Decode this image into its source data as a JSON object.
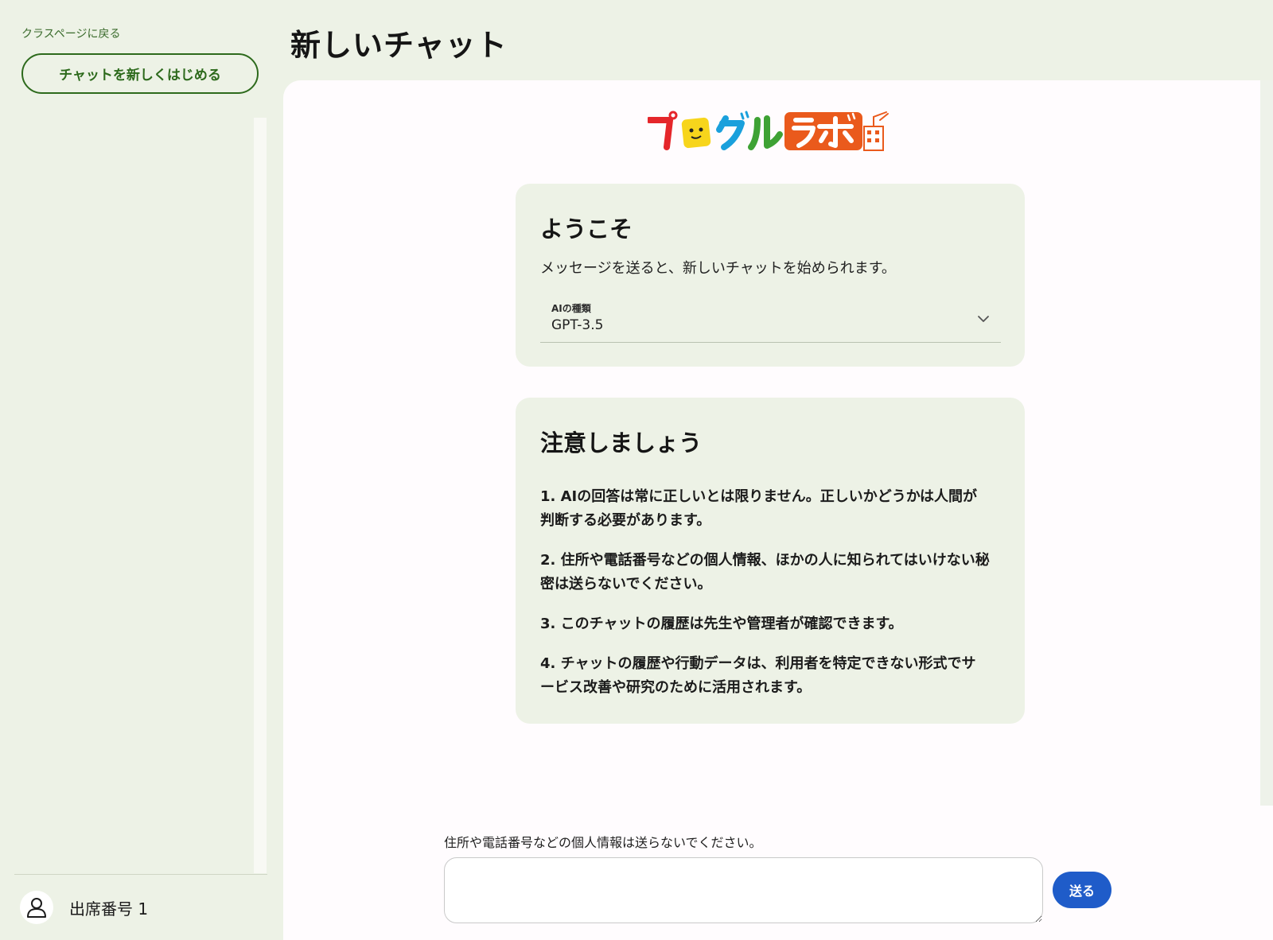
{
  "sidebar": {
    "back_link": "クラスページに戻る",
    "new_chat_label": "チャットを新しくはじめる",
    "user_name": "出席番号 1",
    "user_icon": "user-icon"
  },
  "header": {
    "title": "新しいチャット"
  },
  "logo": {
    "text": "プログルラボ"
  },
  "welcome": {
    "title": "ようこそ",
    "text": "メッセージを送ると、新しいチャットを始められます。",
    "select_label": "AIの種類",
    "select_value": "GPT-3.5",
    "chevron_icon": "chevron-down-icon"
  },
  "caution": {
    "title": "注意しましょう",
    "items": [
      "1. AIの回答は常に正しいとは限りません。正しいかどうかは人間が判断する必要があります。",
      "2. 住所や電話番号などの個人情報、ほかの人に知られてはいけない秘密は送らないでください。",
      "3. このチャットの履歴は先生や管理者が確認できます。",
      "4. チャットの履歴や行動データは、利用者を特定できない形式でサービス改善や研究のために活用されます。"
    ]
  },
  "composer": {
    "hint": "住所や電話番号などの個人情報は送らないでください。",
    "value": "",
    "send_label": "送る"
  },
  "colors": {
    "background": "#edf2e6",
    "panel": "#fffcfe",
    "accent_green": "#2d6a1c",
    "send_blue": "#1f5cc9"
  }
}
